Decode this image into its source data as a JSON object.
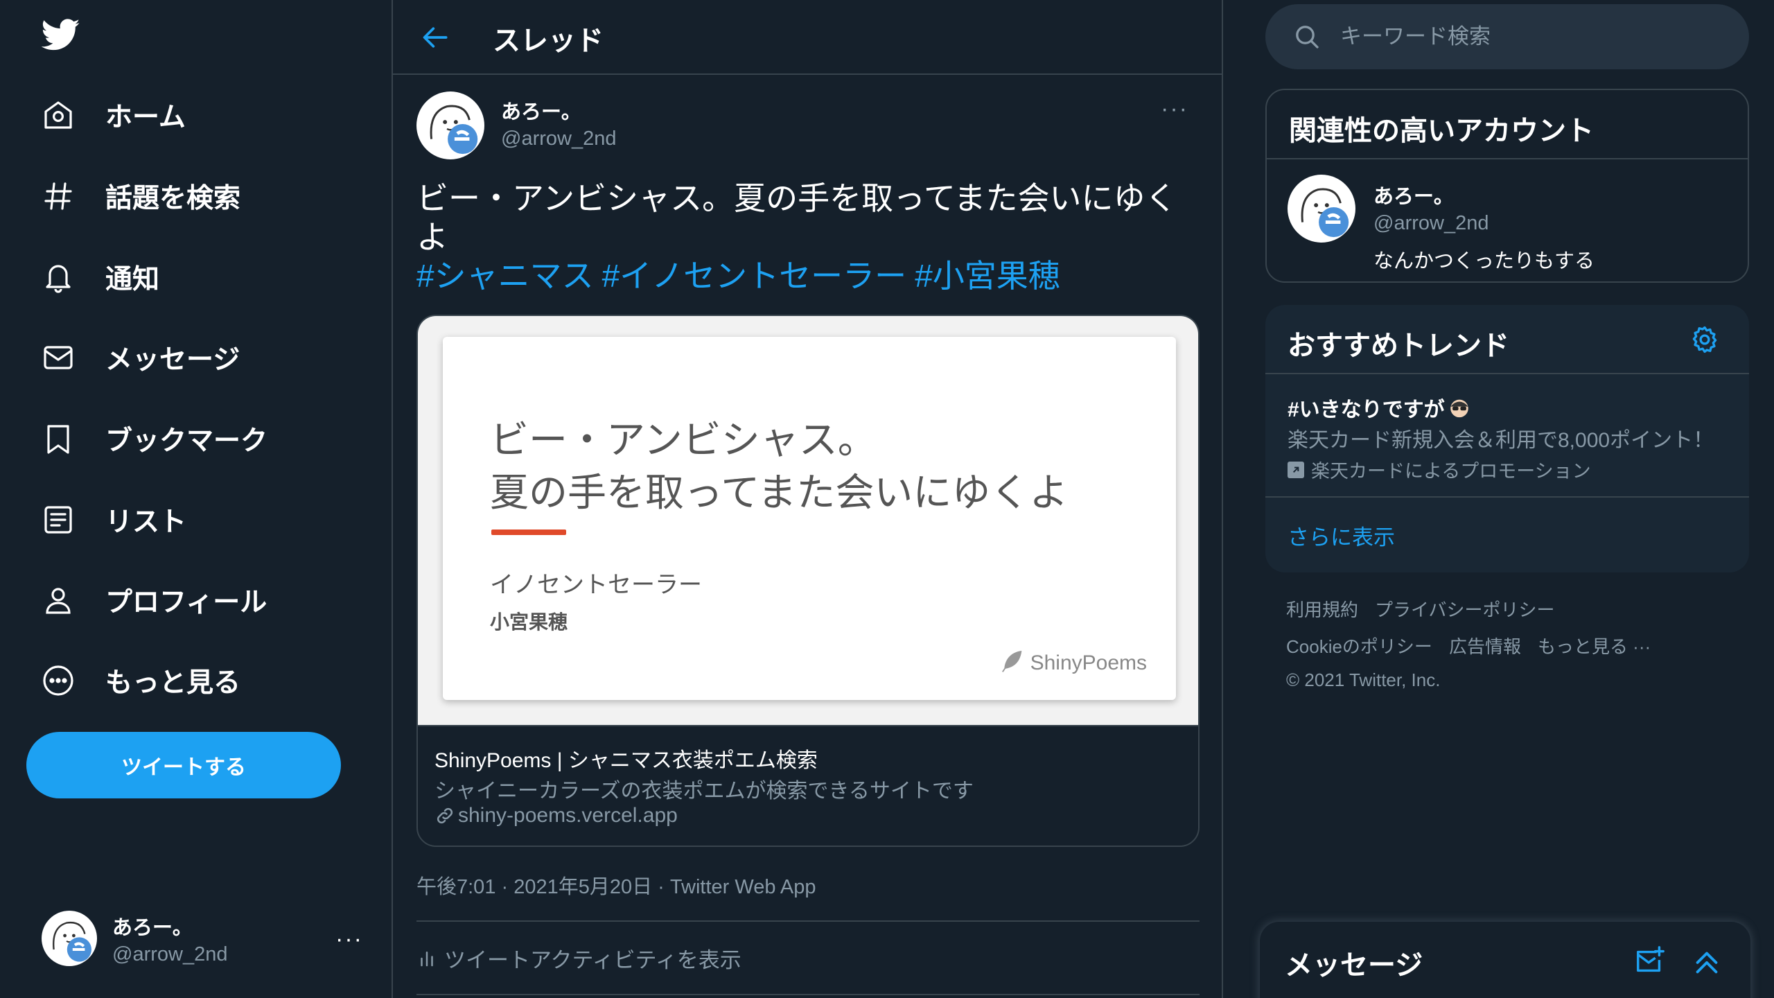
{
  "sidebar": {
    "nav": [
      {
        "label": "ホーム"
      },
      {
        "label": "話題を検索"
      },
      {
        "label": "通知"
      },
      {
        "label": "メッセージ"
      },
      {
        "label": "ブックマーク"
      },
      {
        "label": "リスト"
      },
      {
        "label": "プロフィール"
      },
      {
        "label": "もっと見る"
      }
    ],
    "tweet_button": "ツイートする",
    "account": {
      "name": "あろー。",
      "handle": "@arrow_2nd",
      "more": "···"
    }
  },
  "main": {
    "title": "スレッド",
    "tweet": {
      "author_name": "あろー。",
      "author_handle": "@arrow_2nd",
      "more": "···",
      "text": "ビー・アンビシャス。夏の手を取ってまた会いにゆくよ",
      "hashtags": [
        "#シャニマス",
        "#イノセントセーラー",
        "#小宮果穂"
      ],
      "card": {
        "poem_line1": "ビー・アンビシャス。",
        "poem_line2": "夏の手を取ってまた会いにゆくよ",
        "costume": "イノセントセーラー",
        "idol": "小宮果穂",
        "brand": "ShinyPoems",
        "title": "ShinyPoems | シャニマス衣装ポエム検索",
        "description": "シャイニーカラーズの衣装ポエムが検索できるサイトです",
        "link": "shiny-poems.vercel.app"
      },
      "timestamp": "午後7:01 · 2021年5月20日 · Twitter Web App",
      "activity": "ツイートアクティビティを表示"
    }
  },
  "right": {
    "search_placeholder": "キーワード検索",
    "related": {
      "title": "関連性の高いアカウント",
      "user": {
        "name": "あろー。",
        "handle": "@arrow_2nd",
        "bio": "なんかつくったりもする"
      }
    },
    "trends": {
      "title": "おすすめトレンド",
      "item": {
        "tag": "#いきなりですが",
        "description": "楽天カード新規入会＆利用で8,000ポイント！",
        "promo": "楽天カードによるプロモーション"
      },
      "show_more": "さらに表示"
    },
    "footer": {
      "row1": [
        "利用規約",
        "プライバシーポリシー"
      ],
      "row2": [
        "Cookieのポリシー",
        "広告情報",
        "もっと見る ···"
      ],
      "copyright": "© 2021 Twitter, Inc."
    },
    "messages_drawer": {
      "title": "メッセージ"
    }
  },
  "colors": {
    "background": "#15202b",
    "accent": "#1da1f2",
    "border": "#38444d",
    "secondary_text": "#8899a6",
    "poem_bar": "#e04a2a"
  }
}
